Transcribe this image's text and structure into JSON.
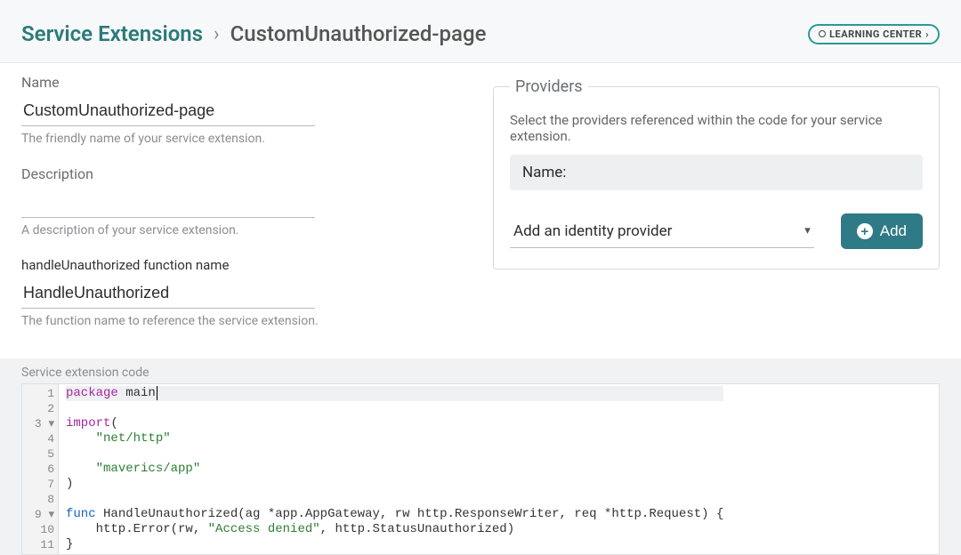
{
  "header": {
    "breadcrumb_root": "Service Extensions",
    "breadcrumb_sep": "›",
    "breadcrumb_current": "CustomUnauthorized-page",
    "learning_center": "LEARNING CENTER",
    "learning_chev": "›"
  },
  "name_field": {
    "label": "Name",
    "value": "CustomUnauthorized-page",
    "help": "The friendly name of your service extension."
  },
  "description_field": {
    "label": "Description",
    "help": "A description of your service extension."
  },
  "func_field": {
    "label": "handleUnauthorized function name",
    "value": "HandleUnauthorized",
    "help": "The function name to reference the service extension."
  },
  "code_section_label": "Service extension code",
  "providers": {
    "legend": "Providers",
    "description": "Select the providers referenced within the code for your service extension.",
    "name_label": "Name:",
    "select_placeholder": "Add an identity provider",
    "add_button": "Add"
  },
  "code": {
    "lines": {
      "1": {
        "kw": "package",
        "id": " main"
      },
      "3": {
        "kw": "import",
        "p": "("
      },
      "4": {
        "indent": "    ",
        "str": "\"net/http\""
      },
      "6": {
        "indent": "    ",
        "str": "\"maverics/app\""
      },
      "7": {
        "p": ")"
      },
      "9a": "func",
      "9b": " HandleUnauthorized",
      "9c": "(ag *app.AppGateway, rw http.ResponseWriter, req *http.Request) {",
      "10a": "    http.Error(rw, ",
      "10b": "\"Access denied\"",
      "10c": ", http.StatusUnauthorized)",
      "11": "}"
    }
  }
}
